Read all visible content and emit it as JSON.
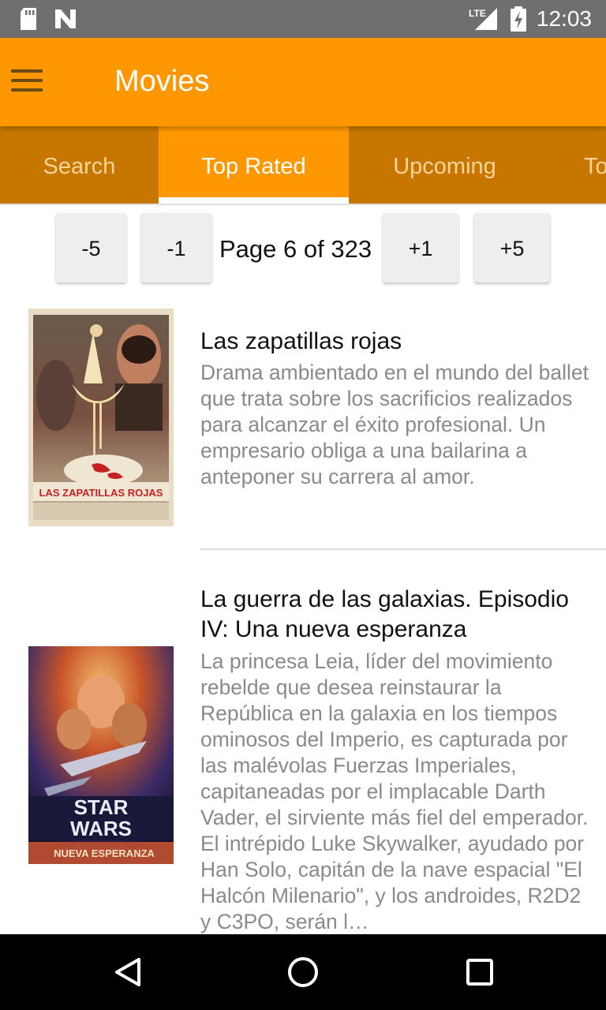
{
  "status_bar": {
    "time": "12:03",
    "network": "LTE"
  },
  "app_bar": {
    "title": "Movies"
  },
  "tabs": [
    {
      "label": "Search"
    },
    {
      "label": "Top Rated"
    },
    {
      "label": "Upcoming"
    },
    {
      "label": "To"
    }
  ],
  "active_tab": "Top Rated",
  "pager": {
    "minus5": "-5",
    "minus1": "-1",
    "page_text": "Page 6 of 323",
    "plus1": "+1",
    "plus5": "+5"
  },
  "movies": [
    {
      "title": "Las zapatillas rojas",
      "description": "Drama ambientado en el mundo del ballet que trata sobre los sacrificios realizados para alcanzar el éxito profesional. Un empresario obliga a una bailarina a anteponer su carrera al amor.",
      "poster_caption": "LAS ZAPATILLAS ROJAS"
    },
    {
      "title": "La guerra de las galaxias. Episodio IV: Una nueva esperanza",
      "description": "La princesa Leia, líder del movimiento rebelde que desea reinstaurar la República en la galaxia en los tiempos ominosos del Imperio, es capturada por las malévolas Fuerzas Imperiales, capitaneadas por el implacable Darth Vader, el sirviente más fiel del emperador. El intrépido Luke Skywalker, ayudado por Han Solo, capitán de la nave espacial \"El Halcón Milenario\", y los androides, R2D2 y C3PO, serán l…",
      "poster_caption_1": "STAR",
      "poster_caption_2": "WARS",
      "poster_caption_3": "NUEVA ESPERANZA"
    }
  ],
  "colors": {
    "primary": "#ff9800",
    "tab_bar": "#c77700",
    "status_bar": "#6f6f6f"
  },
  "icons": {
    "menu": "hamburger-icon",
    "nav_back": "triangle-back-icon",
    "nav_home": "circle-home-icon",
    "nav_recents": "square-recents-icon"
  }
}
